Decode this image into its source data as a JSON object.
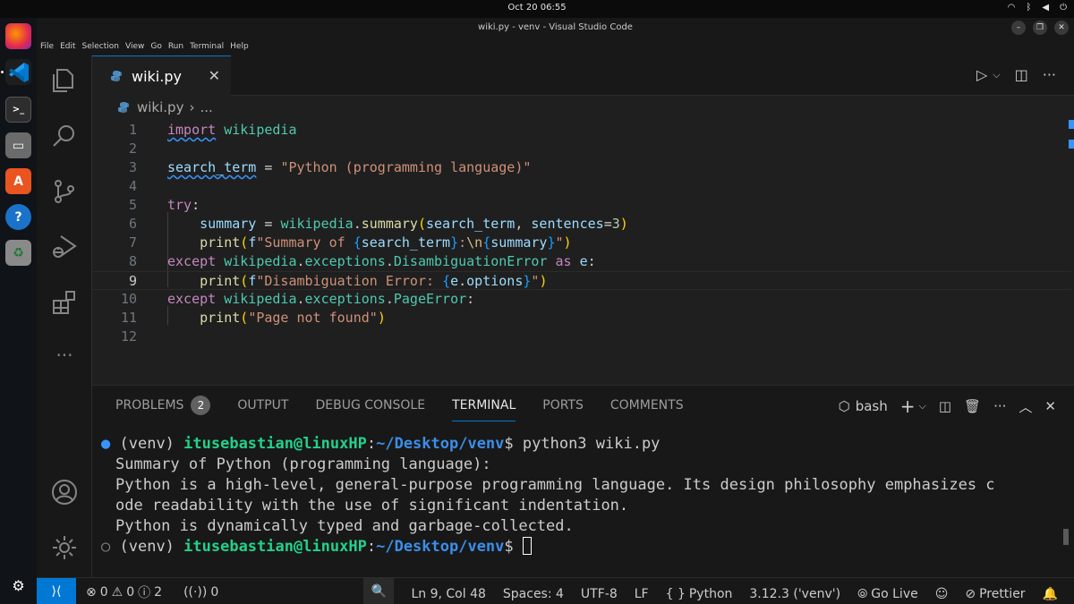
{
  "system": {
    "clock": "Oct 20  06:55",
    "tray": [
      "wifi-icon",
      "bluetooth-icon",
      "volume-icon",
      "power-icon"
    ]
  },
  "window": {
    "title": "wiki.py - venv - Visual Studio Code"
  },
  "menu": {
    "items": [
      "File",
      "Edit",
      "Selection",
      "View",
      "Go",
      "Run",
      "Terminal",
      "Help"
    ]
  },
  "dock": {
    "apps": [
      "firefox-icon",
      "vscode-icon",
      "terminal-icon",
      "files-icon",
      "app-center-icon",
      "help-icon",
      "trash-icon",
      "show-apps-icon"
    ]
  },
  "activity_bar": {
    "items": [
      "explorer-icon",
      "search-icon",
      "source-control-icon",
      "run-debug-icon",
      "extensions-icon",
      "more-icon",
      "accounts-icon",
      "manage-gear-icon"
    ]
  },
  "editor": {
    "tab": {
      "label": "wiki.py",
      "close": "✕"
    },
    "breadcrumb": {
      "file": "wiki.py",
      "separator": "›",
      "rest": "..."
    },
    "line_numbers": [
      "1",
      "2",
      "3",
      "4",
      "5",
      "6",
      "7",
      "8",
      "9",
      "10",
      "11",
      "12"
    ],
    "current_line": 9
  },
  "panel": {
    "tabs": [
      "PROBLEMS",
      "OUTPUT",
      "DEBUG CONSOLE",
      "TERMINAL",
      "PORTS",
      "COMMENTS"
    ],
    "problems_count": "2",
    "active_tab": "TERMINAL",
    "shell": "bash",
    "terminal": {
      "venv": "(venv) ",
      "user_host": "itusebastian@linuxHP",
      "colon": ":",
      "path": "~/Desktop/venv",
      "dollar": "$ ",
      "command": "python3 wiki.py",
      "output": [
        "Summary of Python (programming language):",
        "Python is a high-level, general-purpose programming language. Its design philosophy emphasizes c",
        "ode readability with the use of significant indentation.",
        "Python is dynamically typed and garbage-collected."
      ]
    }
  },
  "status": {
    "errors": "0",
    "warnings": "0",
    "infos": "2",
    "ports": "0",
    "position": "Ln 9, Col 48",
    "spaces": "Spaces: 4",
    "encoding": "UTF-8",
    "eol": "LF",
    "language": "Python",
    "language_icon": "{ }",
    "interpreter": "3.12.3 ('venv')",
    "go_live": "Go Live",
    "prettier": "Prettier"
  },
  "colors": {
    "accent": "#0078d4",
    "keyword": "#c586c0",
    "module": "#4ec9b0",
    "variable": "#9cdcfe",
    "function": "#dcdcaa",
    "string": "#ce9178",
    "number": "#b5cea8",
    "prompt_user": "#23d18b",
    "prompt_path": "#3b8eea"
  }
}
